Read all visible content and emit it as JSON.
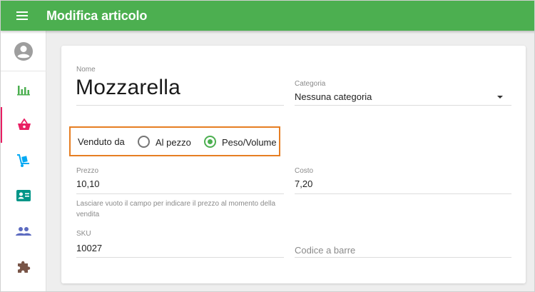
{
  "appbar": {
    "title": "Modifica articolo",
    "menu_icon": "menu-icon"
  },
  "sidebar": {
    "items": [
      {
        "name": "account-icon",
        "color": "#9e9e9e"
      },
      {
        "name": "bar-chart-icon",
        "color": "#4caf50"
      },
      {
        "name": "basket-icon",
        "color": "#e91e63",
        "active": true
      },
      {
        "name": "hand-truck-icon",
        "color": "#03a9f4"
      },
      {
        "name": "contact-card-icon",
        "color": "#009688"
      },
      {
        "name": "people-icon",
        "color": "#5c6bc0"
      },
      {
        "name": "puzzle-icon",
        "color": "#795548"
      }
    ]
  },
  "form": {
    "name": {
      "label": "Nome",
      "value": "Mozzarella"
    },
    "category": {
      "label": "Categoria",
      "value": "Nessuna categoria"
    },
    "sold_by": {
      "label": "Venduto da",
      "options": [
        {
          "label": "Al pezzo",
          "checked": false
        },
        {
          "label": "Peso/Volume",
          "checked": true
        }
      ]
    },
    "price": {
      "label": "Prezzo",
      "value": "10,10",
      "helper": "Lasciare vuoto il campo per indicare il prezzo al momento della vendita"
    },
    "cost": {
      "label": "Costo",
      "value": "7,20"
    },
    "sku": {
      "label": "SKU",
      "value": "10027"
    },
    "barcode": {
      "placeholder": "Codice a barre"
    }
  },
  "colors": {
    "appbar": "#4caf50",
    "highlight_box": "#e67e22",
    "radio_checked": "#4caf50"
  }
}
